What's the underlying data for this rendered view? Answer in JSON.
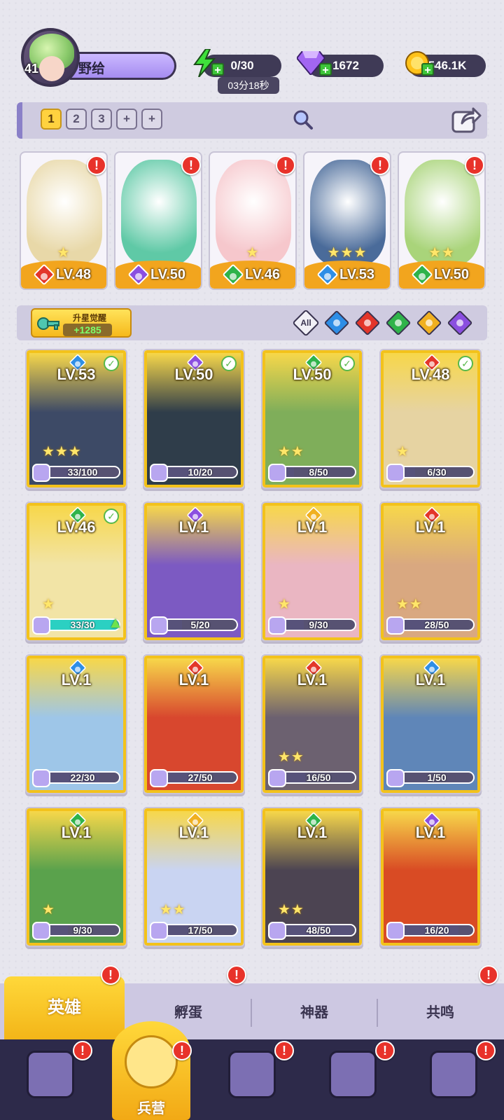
{
  "player": {
    "level": "41",
    "name": "野给"
  },
  "resources": {
    "energy": "0/30",
    "energy_timer": "03分18秒",
    "gems": "1672",
    "gold": "546.1K"
  },
  "team_tabs": [
    "1",
    "2",
    "3",
    "+",
    "+"
  ],
  "team_heroes": [
    {
      "level": "LV.48",
      "element": "fire",
      "stars": 1,
      "color": "#e8d8a8"
    },
    {
      "level": "LV.50",
      "element": "dark",
      "stars": 0,
      "color": "#5fc9a6"
    },
    {
      "level": "LV.46",
      "element": "wind",
      "stars": 1,
      "color": "#f6c7cc"
    },
    {
      "level": "LV.53",
      "element": "water",
      "stars": 3,
      "color": "#4a6b9a"
    },
    {
      "level": "LV.50",
      "element": "wind",
      "stars": 2,
      "color": "#a9d47a"
    }
  ],
  "upstar": {
    "title": "升星觉醒",
    "count": "+1285"
  },
  "filters": {
    "all_label": "All",
    "elements": [
      "water",
      "fire",
      "wind",
      "light",
      "dark"
    ]
  },
  "heroes": [
    {
      "level": "LV.53",
      "element": "water",
      "checked": true,
      "stars": 3,
      "frag": "33/100",
      "progress": 0.33,
      "art": "#3d4a66"
    },
    {
      "level": "LV.50",
      "element": "dark",
      "checked": true,
      "stars": 0,
      "frag": "10/20",
      "progress": 0.5,
      "art": "#2f3d4a"
    },
    {
      "level": "LV.50",
      "element": "wind",
      "checked": true,
      "stars": 2,
      "frag": "8/50",
      "progress": 0.16,
      "art": "#7fae5a"
    },
    {
      "level": "LV.48",
      "element": "fire",
      "checked": true,
      "stars": 1,
      "frag": "6/30",
      "progress": 0.2,
      "art": "#e6d3a2"
    },
    {
      "level": "LV.46",
      "element": "wind",
      "checked": true,
      "stars": 1,
      "frag": "33/30",
      "progress": 1.0,
      "art": "#f2e4a6",
      "upgrade": true
    },
    {
      "level": "LV.1",
      "element": "dark",
      "checked": false,
      "stars": 0,
      "frag": "5/20",
      "progress": 0.25,
      "art": "#7c5ac2"
    },
    {
      "level": "LV.1",
      "element": "light",
      "checked": false,
      "stars": 1,
      "frag": "9/30",
      "progress": 0.3,
      "art": "#eab6c2"
    },
    {
      "level": "LV.1",
      "element": "fire",
      "checked": false,
      "stars": 2,
      "frag": "28/50",
      "progress": 0.56,
      "art": "#d9a880"
    },
    {
      "level": "LV.1",
      "element": "water",
      "checked": false,
      "stars": 0,
      "frag": "22/30",
      "progress": 0.73,
      "art": "#9ec6e8"
    },
    {
      "level": "LV.1",
      "element": "fire",
      "checked": false,
      "stars": 0,
      "frag": "27/50",
      "progress": 0.54,
      "art": "#d8472e"
    },
    {
      "level": "LV.1",
      "element": "fire",
      "checked": false,
      "stars": 2,
      "frag": "16/50",
      "progress": 0.32,
      "art": "#6c6170"
    },
    {
      "level": "LV.1",
      "element": "water",
      "checked": false,
      "stars": 0,
      "frag": "1/50",
      "progress": 0.02,
      "art": "#5f86b8"
    },
    {
      "level": "LV.1",
      "element": "wind",
      "checked": false,
      "stars": 1,
      "frag": "9/30",
      "progress": 0.3,
      "art": "#5aa24c"
    },
    {
      "level": "LV.1",
      "element": "light",
      "checked": false,
      "stars": 2,
      "frag": "17/50",
      "progress": 0.34,
      "art": "#c9d4f2"
    },
    {
      "level": "LV.1",
      "element": "wind",
      "checked": false,
      "stars": 2,
      "frag": "48/50",
      "progress": 0.96,
      "art": "#4c4452"
    },
    {
      "level": "LV.1",
      "element": "dark",
      "checked": false,
      "stars": 0,
      "frag": "16/20",
      "progress": 0.8,
      "art": "#d94b24"
    }
  ],
  "subtabs": [
    "英雄",
    "孵蛋",
    "神器",
    "共鸣"
  ],
  "bottom_nav": [
    {
      "icon": "cards-icon",
      "label": ""
    },
    {
      "icon": "barracks-icon",
      "label": "兵营"
    },
    {
      "icon": "map-icon",
      "label": ""
    },
    {
      "icon": "temple-icon",
      "label": ""
    },
    {
      "icon": "mushroom-house-icon",
      "label": ""
    }
  ]
}
